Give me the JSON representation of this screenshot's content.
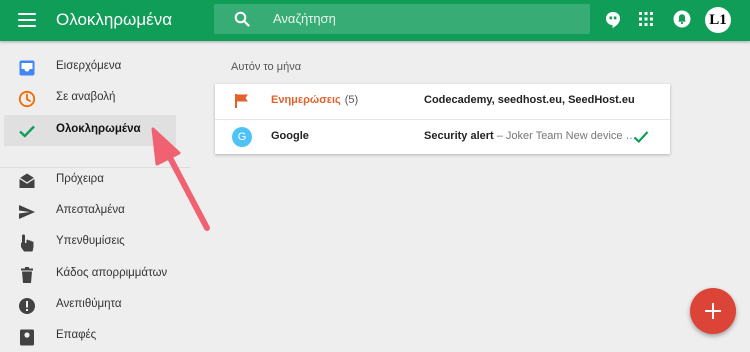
{
  "app": {
    "title": "Ολοκληρωμένα",
    "brand_color": "#0f9d58"
  },
  "search": {
    "placeholder": "Αναζήτηση"
  },
  "top_icons": [
    "hangouts-icon",
    "apps-grid-icon",
    "notifications-icon"
  ],
  "account": {
    "avatar_text": "L1"
  },
  "sidebar": {
    "items": [
      {
        "label": "Εισερχόμενα",
        "icon": "inbox-icon",
        "color": "#4285f4"
      },
      {
        "label": "Σε αναβολή",
        "icon": "clock-icon",
        "color": "#ef6c00"
      },
      {
        "label": "Ολοκληρωμένα",
        "icon": "check-icon",
        "color": "#0f9d58",
        "active": true
      },
      {
        "label": "Πρόχειρα",
        "icon": "drafts-icon",
        "color": "#424242"
      },
      {
        "label": "Απεσταλμένα",
        "icon": "send-icon",
        "color": "#424242"
      },
      {
        "label": "Υπενθυμίσεις",
        "icon": "reminder-hand-icon",
        "color": "#424242"
      },
      {
        "label": "Κάδος απορριμμάτων",
        "icon": "trash-icon",
        "color": "#424242"
      },
      {
        "label": "Ανεπιθύμητα",
        "icon": "spam-icon",
        "color": "#424242"
      },
      {
        "label": "Επαφές",
        "icon": "contacts-icon",
        "color": "#424242"
      }
    ]
  },
  "main": {
    "section_header": "Αυτόν το μήνα",
    "rows": [
      {
        "sender": "Ενημερώσεις",
        "count": "(5)",
        "subject": "Codecademy, seedhost.eu, SeedHost.eu",
        "snippet": "",
        "icon": "flag-icon",
        "color": "#e3622c"
      },
      {
        "sender": "Google",
        "avatar_letter": "G",
        "subject": "Security alert",
        "snippet": " – Joker Team New device …",
        "icon": "avatar",
        "done": true
      }
    ]
  },
  "fab": {
    "icon": "plus-icon",
    "color": "#db4437"
  }
}
